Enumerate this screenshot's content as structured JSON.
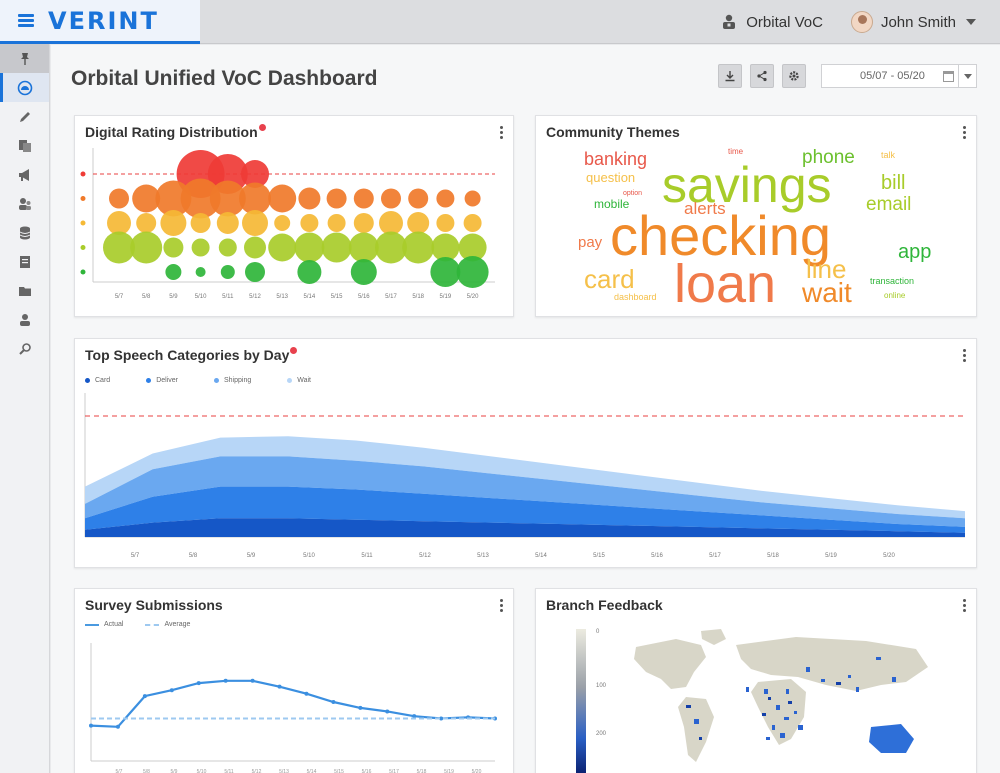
{
  "brand": {
    "name": "VERINT"
  },
  "header": {
    "workspace": "Orbital VoC",
    "user": "John Smith"
  },
  "sidebar": {
    "items": [
      "pin-icon",
      "dashboard-icon",
      "pencil-icon",
      "documents-icon",
      "megaphone-icon",
      "users-icon",
      "database-icon",
      "reports-icon",
      "folder-icon",
      "admin-icon",
      "search-icon"
    ]
  },
  "page": {
    "title": "Orbital Unified VoC Dashboard",
    "date_range": "05/07 - 05/20"
  },
  "colors": {
    "accent": "#1a73d9",
    "alert": "#e8414d"
  },
  "cards": {
    "rating": {
      "title": "Digital Rating Distribution",
      "chart_data": {
        "type": "scatter",
        "x": [
          "5/7",
          "5/8",
          "5/9",
          "5/10",
          "5/11",
          "5/12",
          "5/13",
          "5/14",
          "5/15",
          "5/16",
          "5/17",
          "5/18",
          "5/19",
          "5/20"
        ],
        "rows": [
          {
            "color": "#ef3b36",
            "sizes": [
              0,
              0,
              0,
              24,
              20,
              14,
              0,
              0,
              0,
              0,
              0,
              0,
              0,
              0
            ]
          },
          {
            "color": "#f07a2a",
            "sizes": [
              10,
              14,
              18,
              20,
              18,
              16,
              14,
              11,
              10,
              10,
              10,
              10,
              9,
              8
            ]
          },
          {
            "color": "#f5b935",
            "sizes": [
              12,
              10,
              13,
              10,
              11,
              13,
              8,
              9,
              9,
              10,
              12,
              11,
              9,
              9
            ]
          },
          {
            "color": "#a8cc2a",
            "sizes": [
              16,
              16,
              10,
              9,
              9,
              11,
              14,
              15,
              15,
              15,
              16,
              16,
              14,
              14
            ]
          },
          {
            "color": "#2fb53a",
            "sizes": [
              0,
              0,
              8,
              5,
              7,
              10,
              0,
              12,
              0,
              13,
              0,
              0,
              15,
              16
            ]
          }
        ],
        "threshold": "dashed-red"
      }
    },
    "themes": {
      "title": "Community Themes",
      "words": [
        {
          "text": "banking",
          "color": "#e8584a"
        },
        {
          "text": "time",
          "color": "#e8584a"
        },
        {
          "text": "phone",
          "color": "#6cc02e"
        },
        {
          "text": "talk",
          "color": "#f5c04a"
        },
        {
          "text": "question",
          "color": "#f5c04a"
        },
        {
          "text": "savings",
          "color": "#a8cc2a"
        },
        {
          "text": "bill",
          "color": "#a8cc2a"
        },
        {
          "text": "option",
          "color": "#e8584a"
        },
        {
          "text": "mobile",
          "color": "#2fb53a"
        },
        {
          "text": "alerts",
          "color": "#f07a4a"
        },
        {
          "text": "email",
          "color": "#a8cc2a"
        },
        {
          "text": "pay",
          "color": "#f07a4a"
        },
        {
          "text": "checking",
          "color": "#f08a2a"
        },
        {
          "text": "app",
          "color": "#2fb53a"
        },
        {
          "text": "card",
          "color": "#f5c04a"
        },
        {
          "text": "loan",
          "color": "#f07a4a"
        },
        {
          "text": "line",
          "color": "#f5c04a"
        },
        {
          "text": "transaction",
          "color": "#2fb53a"
        },
        {
          "text": "dashboard",
          "color": "#f5c04a"
        },
        {
          "text": "wait",
          "color": "#f08a2a"
        },
        {
          "text": "online",
          "color": "#a8cc2a"
        }
      ]
    },
    "speech": {
      "title": "Top Speech Categories by Day",
      "chart_data": {
        "type": "area",
        "stacked": true,
        "categories": [
          "5/7",
          "5/8",
          "5/9",
          "5/10",
          "5/11",
          "5/12",
          "5/13",
          "5/14",
          "5/15",
          "5/16",
          "5/17",
          "5/18",
          "5/19",
          "5/20"
        ],
        "series": [
          {
            "name": "Card",
            "color": "#1557c7",
            "values": [
              5,
              10,
              13,
              13,
              12,
              11,
              10,
              9,
              8,
              7,
              6,
              5,
              4,
              3
            ]
          },
          {
            "name": "Deliver",
            "color": "#2e80e8",
            "values": [
              8,
              18,
              22,
              22,
              21,
              19,
              17,
              15,
              13,
              11,
              9,
              7,
              5,
              4
            ]
          },
          {
            "name": "Shipping",
            "color": "#6aa8f0",
            "values": [
              10,
              19,
              21,
              21,
              20,
              19,
              17,
              15,
              13,
              11,
              9,
              8,
              7,
              6
            ]
          },
          {
            "name": "Wait",
            "color": "#b7d6f7",
            "values": [
              12,
              11,
              13,
              14,
              14,
              13,
              12,
              11,
              10,
              9,
              8,
              7,
              6,
              5
            ]
          }
        ],
        "ylim": [
          0,
          100
        ],
        "threshold": 84
      }
    },
    "survey": {
      "title": "Survey Submissions",
      "chart_data": {
        "type": "line",
        "x": [
          "5/7",
          "5/8",
          "5/9",
          "5/10",
          "5/11",
          "5/12",
          "5/13",
          "5/14",
          "5/15",
          "5/16",
          "5/17",
          "5/18",
          "5/19",
          "5/20"
        ],
        "series": [
          {
            "name": "Actual",
            "color": "#3b8fe0",
            "values": [
              30,
              29,
              55,
              60,
              66,
              68,
              68,
              63,
              57,
              50,
              45,
              42,
              38,
              36,
              37,
              36
            ]
          },
          {
            "name": "Average",
            "color": "#9ec9f0",
            "values": [
              36,
              36,
              36,
              36,
              36,
              36,
              36,
              36,
              36,
              36,
              36,
              36,
              36,
              36,
              36,
              36
            ]
          }
        ],
        "ylim": [
          0,
          100
        ]
      }
    },
    "branch": {
      "title": "Branch Feedback",
      "scale_labels": [
        "0",
        "100",
        "200"
      ]
    }
  }
}
